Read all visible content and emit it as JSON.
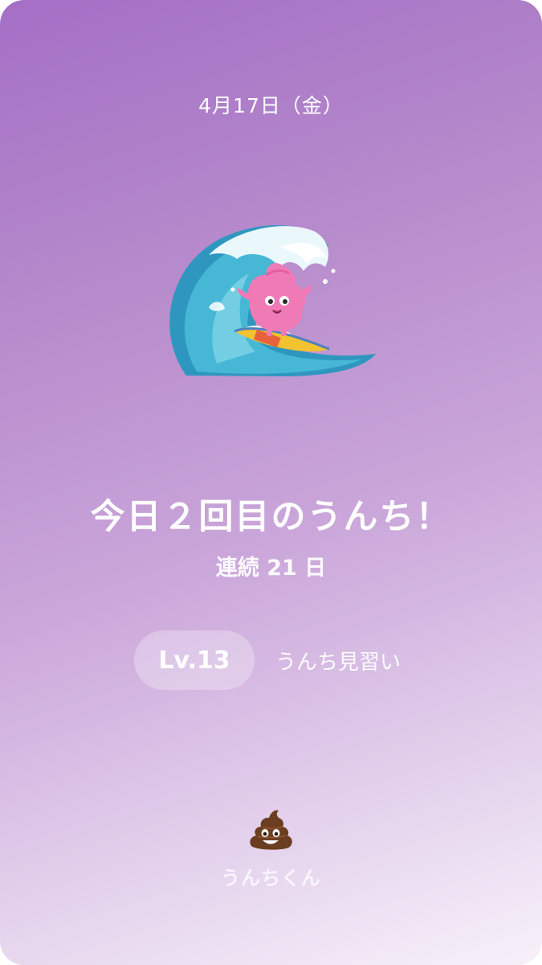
{
  "header": {
    "date": "4月17日（金）"
  },
  "main": {
    "illustration_icon": "wave-surfing-mascot-icon",
    "headline": "今日２回目のうんち！",
    "streak": "連続 21 日"
  },
  "level": {
    "badge": "Lv.13",
    "title": "うんち見習い"
  },
  "footer": {
    "app_icon": "poop-emoji-icon",
    "app_name": "うんちくん"
  },
  "colors": {
    "gradient_top": "#a46fc6",
    "gradient_bottom": "#f7f1fa",
    "wave": "#3aa6c9",
    "mascot": "#f07ab6"
  }
}
